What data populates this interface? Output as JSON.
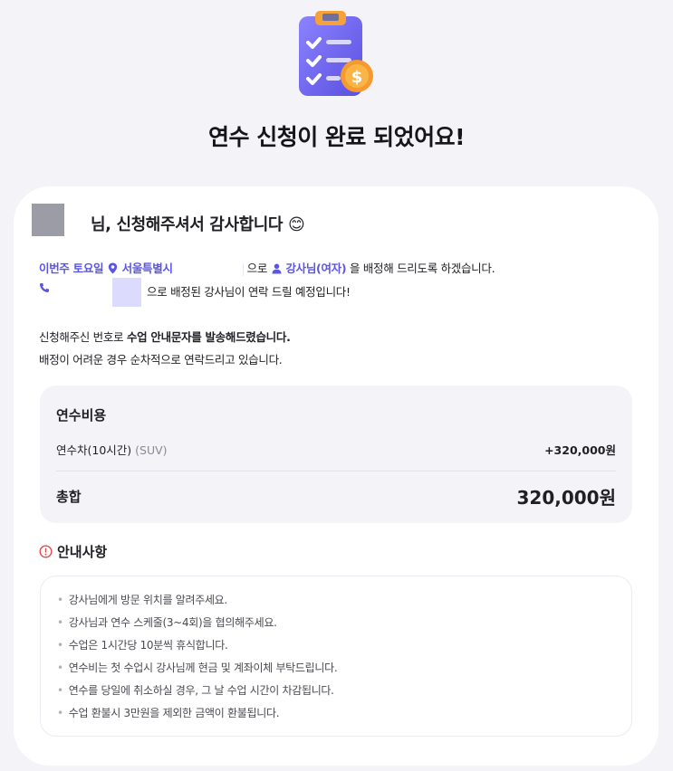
{
  "title": "연수 신청이 완료 되었어요!",
  "greeting": "님, 신청해주셔서 감사합니다 😊",
  "assignment": {
    "schedule": "이번주 토요일",
    "location": "서울특별시",
    "connector": "으로",
    "instructor": "강사님(여자)",
    "tail": "을 배정해 드리도록 하겠습니다.",
    "contact_text": "으로 배정된 강사님이 연락 드릴 예정입니다!"
  },
  "message": {
    "line1_prefix": "신청해주신 번호로",
    "line1_bold": "수업 안내문자를 발송해드렸습니다.",
    "line2": "배정이 어려운 경우 순차적으로 연락드리고 있습니다."
  },
  "cost": {
    "title": "연수비용",
    "item_name": "연수차(10시간)",
    "item_sub": "(SUV)",
    "item_amount": "+320,000원",
    "total_label": "총합",
    "total_amount": "320,000원"
  },
  "notice": {
    "title": "안내사항",
    "items": [
      "강사님에게 방문 위치를 알려주세요.",
      "강사님과 연수 스케줄(3~4회)을 협의해주세요.",
      "수업은 1시간당 10분씩 휴식합니다.",
      "연수비는 첫 수업시 강사님께 현금 및 계좌이체 부탁드립니다.",
      "연수를 당일에 취소하실 경우, 그 날 수업 시간이 차감됩니다.",
      "수업 환불시 3만원을 제외한 금액이 환불됩니다."
    ]
  },
  "colors": {
    "accent": "#5b55e6",
    "background": "#f4f4f8",
    "card": "#ffffff",
    "notice_icon": "#e5484d",
    "redaction_avatar": "#9c9ca6",
    "redaction_phone": "#dcdafd"
  },
  "icons": [
    "clipboard-coin-icon",
    "location-pin-icon",
    "person-icon",
    "phone-icon",
    "info-circle-icon"
  ]
}
